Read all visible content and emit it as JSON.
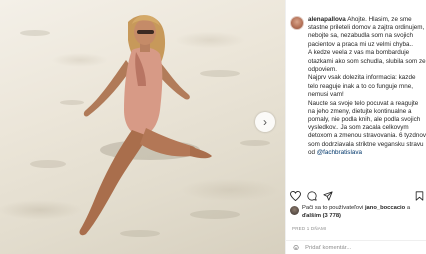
{
  "post": {
    "username": "alenapallova",
    "caption_lines": [
      "Ahojte. Hlasim, ze sme",
      "stastne prileteli domov a zajtra",
      "ordinujem, nebojte sa, nezabudla som",
      "na svojich pacientov a praca mi uz",
      "velmi chyba..",
      "A kedze veela z vas ma bombarduje",
      "otazkami ako som schudla, slubila",
      "som ze odpoviem.",
      "Najprv vsak dolezita informacia: kazde",
      "telo reaguje inak a to co funguje mne,",
      "nemusi vam!",
      "Naucte sa svoje telo pocuvat a",
      "reagujte na jeho zmeny, dietujte",
      "kontinualne a pomaly, nie podla knih,",
      "ale podla svojich vysledkov..",
      "Ja som zacala celkovym detoxom a",
      "zmenou stravovania.",
      "6 tyzdnov som dodrziavala striktne",
      "vegansku stravu od"
    ],
    "mention": "@fachbratislava",
    "liked_by_prefix": "Pači sa to používateľovi",
    "liked_by_user": "jano_boccacio",
    "liked_by_middle": "a",
    "liked_by_others": "ďalším (3 778)",
    "date": "PRED 1 DŇAMI",
    "comment_placeholder": "Pridať komentár..."
  },
  "icons": {
    "like": "heart-icon",
    "comment": "comment-icon",
    "share": "share-icon",
    "save": "bookmark-icon",
    "next": "chevron-right-icon",
    "emoji": "smiley-icon"
  },
  "colors": {
    "mention": "#00376b",
    "secondary": "#8e8e8e"
  }
}
